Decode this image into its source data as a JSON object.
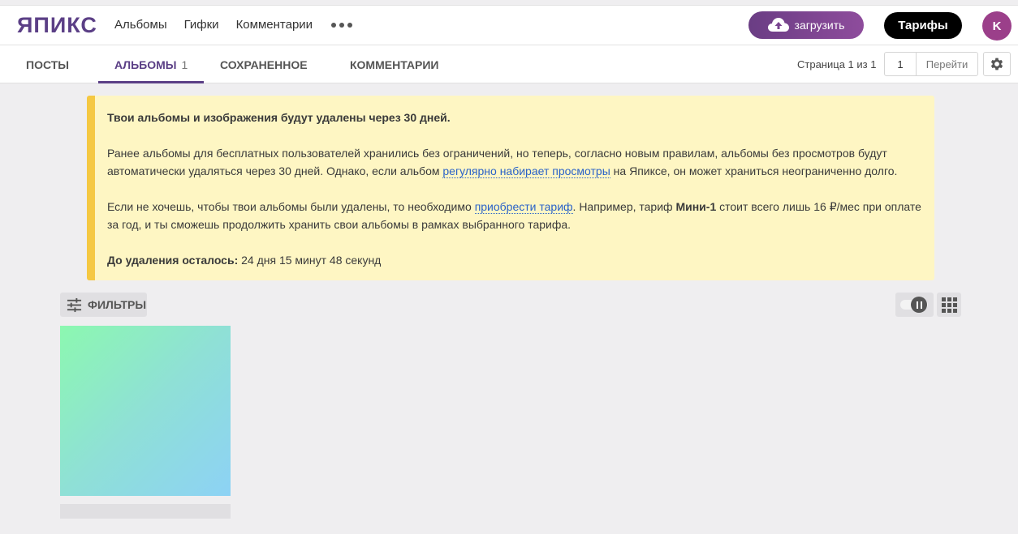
{
  "header": {
    "logo": "ЯПИКС",
    "nav": [
      "Альбомы",
      "Гифки",
      "Комментарии"
    ],
    "upload_label": "загрузить",
    "tariffs_label": "Тарифы",
    "avatar_letter": "K"
  },
  "tabs": [
    {
      "label": "ПОСТЫ"
    },
    {
      "label": "АЛЬБОМЫ",
      "count": "1",
      "active": true
    },
    {
      "label": "СОХРАНЕННОЕ"
    },
    {
      "label": "КОММЕНТАРИИ"
    }
  ],
  "pager": {
    "label": "Страница 1 из 1",
    "current": "1",
    "go_label": "Перейти"
  },
  "notice": {
    "title": "Твои альбомы и изображения будут удалены через 30 дней.",
    "p1_before": "Ранее альбомы для бесплатных пользователей хранились без ограничений, но теперь, согласно новым правилам, альбомы без просмотров будут автоматически удаляться через 30 дней. Однако, если альбом ",
    "p1_link": "регулярно набирает просмотры",
    "p1_after": " на Япиксе, он может храниться неограниченно долго.",
    "p2_before": "Если не хочешь, чтобы твои альбомы были удалены, то необходимо ",
    "p2_link": "приобрести тариф",
    "p2_mid": ". Например, тариф ",
    "p2_bold": "Мини-1",
    "p2_after": " стоит всего лишь 16 ₽/мес при оплате за год, и ты сможешь продолжить хранить свои альбомы в рамках выбранного тарифа.",
    "countdown_label": "До удаления осталось:",
    "countdown_value": " 24 дня 15 минут 48 секунд"
  },
  "toolbar": {
    "filters_label": "ФИЛЬТРЫ"
  },
  "colors": {
    "brand": "#5b3f86",
    "notice_bg": "#fef6c3",
    "notice_accent": "#f5c842"
  }
}
